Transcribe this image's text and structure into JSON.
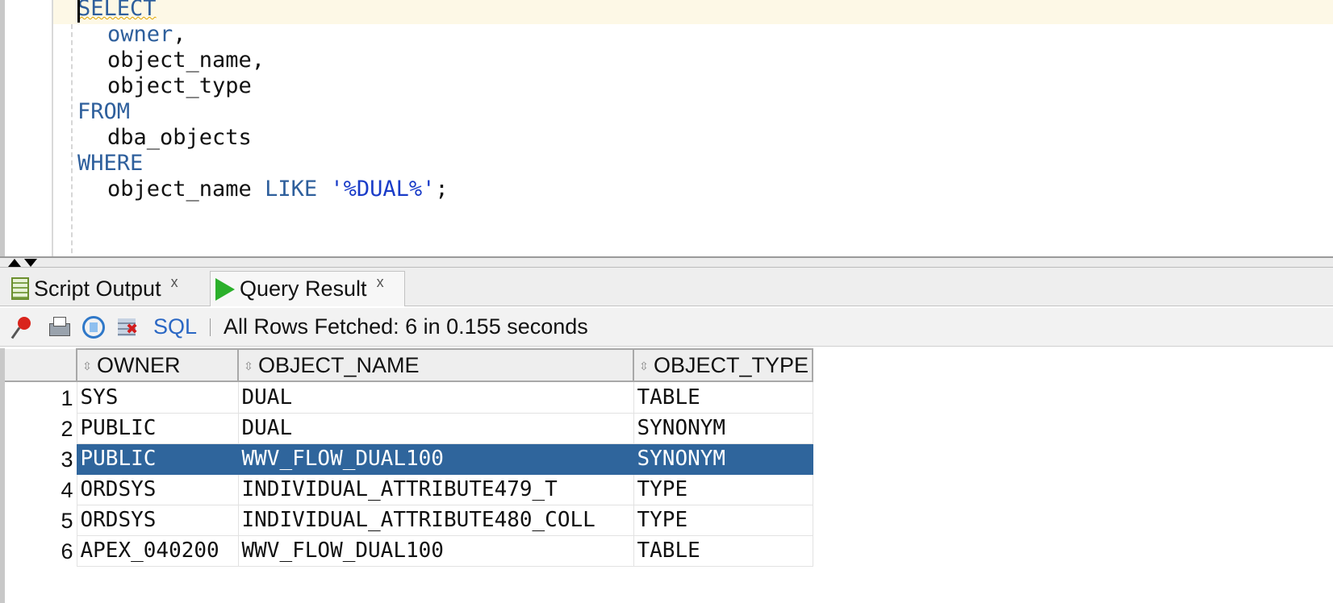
{
  "editor": {
    "lines": [
      {
        "indent": 0,
        "parts": [
          {
            "t": "SELECT",
            "c": "kw squiggle"
          }
        ]
      },
      {
        "indent": 1,
        "parts": [
          {
            "t": "owner",
            "c": "kw"
          },
          {
            "t": ",",
            "c": ""
          }
        ]
      },
      {
        "indent": 1,
        "parts": [
          {
            "t": "object_name,",
            "c": ""
          }
        ]
      },
      {
        "indent": 1,
        "parts": [
          {
            "t": "object_type",
            "c": ""
          }
        ]
      },
      {
        "indent": 0,
        "parts": [
          {
            "t": "FROM",
            "c": "kw"
          }
        ]
      },
      {
        "indent": 1,
        "parts": [
          {
            "t": "dba_objects",
            "c": ""
          }
        ]
      },
      {
        "indent": 0,
        "parts": [
          {
            "t": "WHERE",
            "c": "kw"
          }
        ]
      },
      {
        "indent": 1,
        "parts": [
          {
            "t": "object_name ",
            "c": ""
          },
          {
            "t": "LIKE",
            "c": "kw"
          },
          {
            "t": " ",
            "c": ""
          },
          {
            "t": "'%DUAL%'",
            "c": "str"
          },
          {
            "t": ";",
            "c": ""
          }
        ]
      }
    ]
  },
  "tabs": {
    "script_output": "Script Output",
    "query_result": "Query Result",
    "close": "x"
  },
  "toolbar": {
    "sql_label": "SQL",
    "status": "All Rows Fetched: 6 in 0.155 seconds"
  },
  "grid": {
    "sort_glyph": "⇳",
    "columns": [
      "OWNER",
      "OBJECT_NAME",
      "OBJECT_TYPE"
    ],
    "selected_row": 3,
    "rows": [
      {
        "n": "1",
        "cells": [
          "SYS",
          "DUAL",
          "TABLE"
        ]
      },
      {
        "n": "2",
        "cells": [
          "PUBLIC",
          "DUAL",
          "SYNONYM"
        ]
      },
      {
        "n": "3",
        "cells": [
          "PUBLIC",
          "WWV_FLOW_DUAL100",
          "SYNONYM"
        ]
      },
      {
        "n": "4",
        "cells": [
          "ORDSYS",
          "INDIVIDUAL_ATTRIBUTE479_T",
          "TYPE"
        ]
      },
      {
        "n": "5",
        "cells": [
          "ORDSYS",
          "INDIVIDUAL_ATTRIBUTE480_COLL",
          "TYPE"
        ]
      },
      {
        "n": "6",
        "cells": [
          "APEX_040200",
          "WWV_FLOW_DUAL100",
          "TABLE"
        ]
      }
    ]
  },
  "icons": {
    "pin": "pin-icon",
    "print": "printer-icon",
    "refresh": "refresh-icon",
    "cancel": "cancel-fetch-icon",
    "script_tab": "script-document-icon",
    "query_tab": "run-query-icon"
  },
  "colors": {
    "keyword": "#2e5f9c",
    "string": "#1a3cc8",
    "selection": "#2f659c",
    "current_line": "#fdf8e6"
  }
}
